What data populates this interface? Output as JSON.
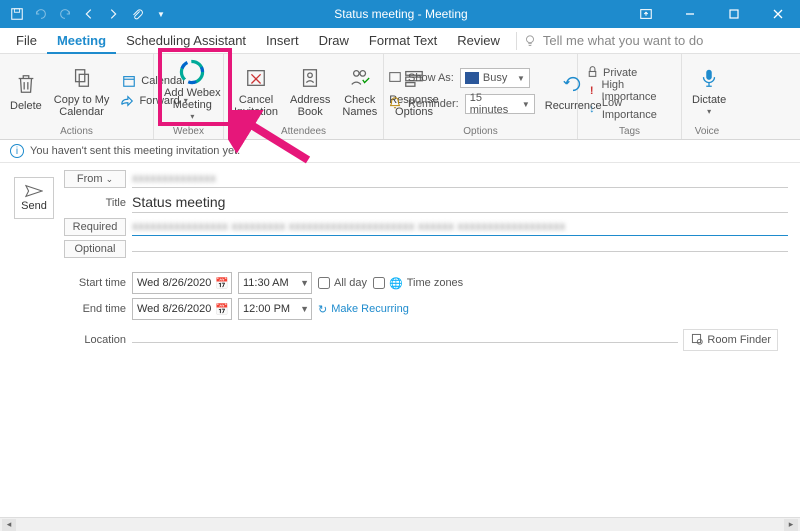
{
  "titlebar": {
    "title": "Status meeting - Meeting"
  },
  "tabs": {
    "file": "File",
    "meeting": "Meeting",
    "scheduling": "Scheduling Assistant",
    "insert": "Insert",
    "draw": "Draw",
    "format": "Format Text",
    "review": "Review",
    "tellme": "Tell me what you want to do"
  },
  "ribbon": {
    "actions": {
      "label": "Actions",
      "delete": "Delete",
      "copytocal": "Copy to My\nCalendar",
      "calendar": "Calendar",
      "forward": "Forward"
    },
    "webex": {
      "label": "Webex",
      "add": "Add Webex\nMeeting"
    },
    "attendees": {
      "label": "Attendees",
      "cancel": "Cancel\nInvitation",
      "address": "Address\nBook",
      "check": "Check\nNames",
      "response": "Response\nOptions"
    },
    "options": {
      "label": "Options",
      "showas": "Show As:",
      "busy": "Busy",
      "reminder": "Reminder:",
      "reminder_val": "15 minutes",
      "recurrence": "Recurrence"
    },
    "tags": {
      "label": "Tags",
      "private": "Private",
      "high": "High Importance",
      "low": "Low Importance"
    },
    "voice": {
      "label": "Voice",
      "dictate": "Dictate"
    }
  },
  "infobar": {
    "text": "You haven't sent this meeting invitation yet."
  },
  "form": {
    "send": "Send",
    "from": "From",
    "title_label": "Title",
    "title_value": "Status meeting",
    "required": "Required",
    "optional": "Optional",
    "start": "Start time",
    "end": "End time",
    "date": "Wed 8/26/2020",
    "start_time": "11:30 AM",
    "end_time": "12:00 PM",
    "allday": "All day",
    "timezones": "Time zones",
    "recurring": "Make Recurring",
    "location": "Location",
    "roomfinder": "Room Finder"
  }
}
